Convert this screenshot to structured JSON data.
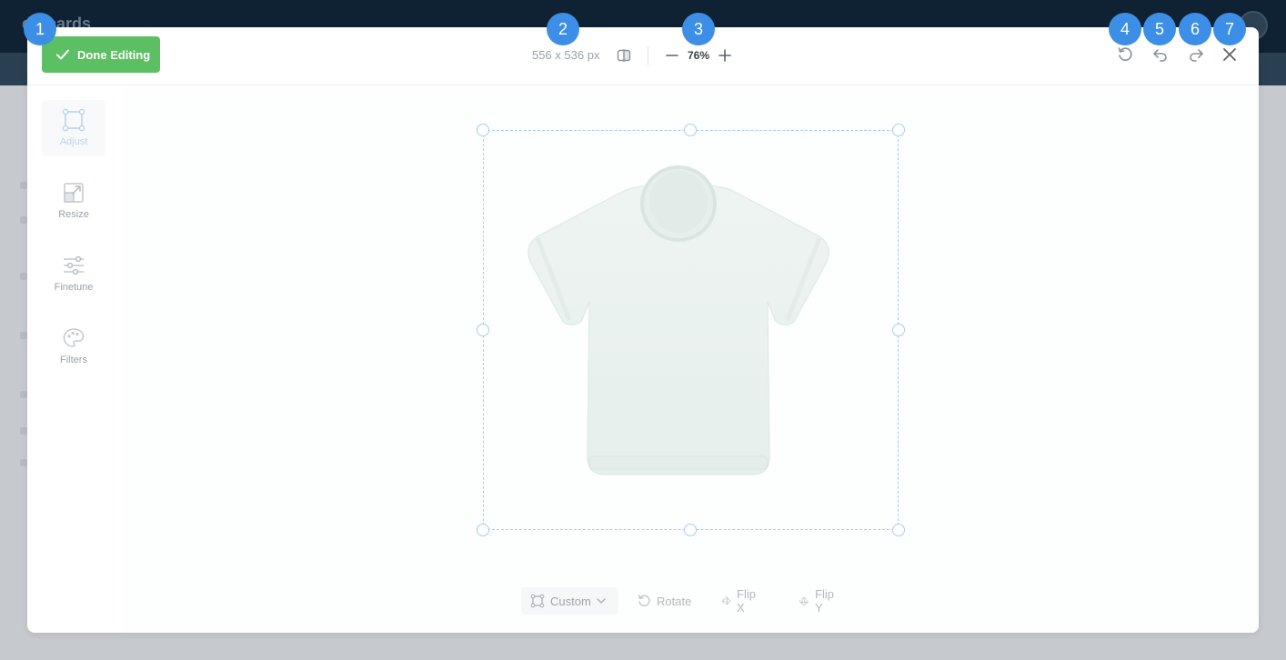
{
  "background": {
    "brand": "dotcards"
  },
  "header": {
    "done_label": "Done Editing",
    "dimensions": "556 x 536 px",
    "zoom": "76%"
  },
  "sidebar": {
    "items": [
      {
        "label": "Adjust",
        "icon": "crop-frame-icon"
      },
      {
        "label": "Resize",
        "icon": "resize-icon"
      },
      {
        "label": "Finetune",
        "icon": "sliders-icon"
      },
      {
        "label": "Filters",
        "icon": "palette-icon"
      }
    ]
  },
  "toolbar": {
    "custom_label": "Custom",
    "rotate_label": "Rotate",
    "flipx_label": "Flip X",
    "flipy_label": "Flip Y"
  },
  "badges": [
    "1",
    "2",
    "3",
    "4",
    "5",
    "6",
    "7"
  ],
  "colors": {
    "accent_green": "#5dbf63",
    "badge_blue": "#3d8ee6",
    "crop_blue": "#a9cdf1"
  }
}
